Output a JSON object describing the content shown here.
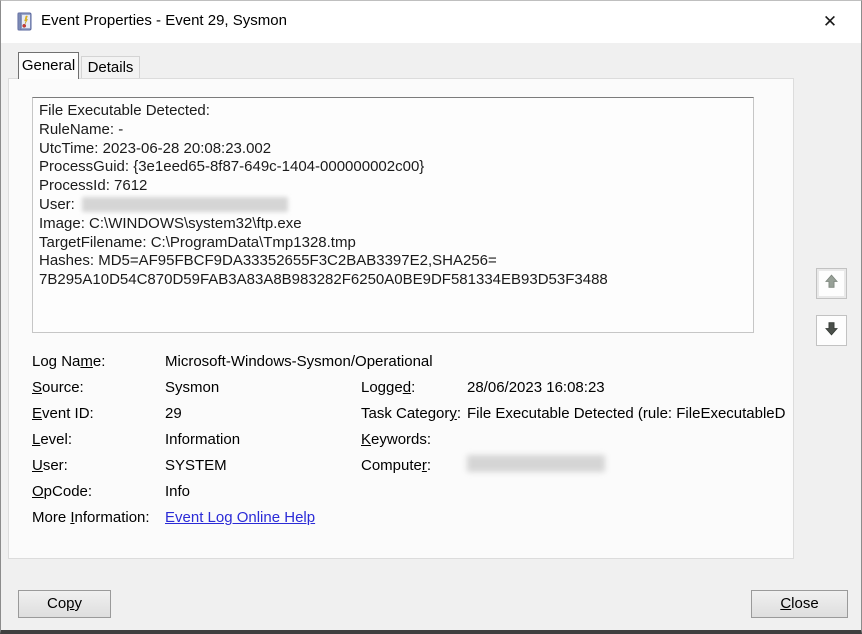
{
  "window": {
    "title": "Event Properties - Event 29, Sysmon",
    "close_glyph": "✕"
  },
  "tabs": {
    "general": "General",
    "details": "Details"
  },
  "description": {
    "lines": [
      "File Executable Detected:",
      "RuleName: -",
      "UtcTime: 2023-06-28 20:08:23.002",
      "ProcessGuid: {3e1eed65-8f87-649c-1404-000000002c00}",
      "ProcessId: 7612",
      "User:",
      "Image: C:\\WINDOWS\\system32\\ftp.exe",
      "TargetFilename: C:\\ProgramData\\Tmp1328.tmp",
      "Hashes: MD5=AF95FBCF9DA33352655F3C2BAB3397E2,SHA256=",
      "7B295A10D54C870D59FAB3A83A8B983282F6250A0BE9DF581334EB93D53F3488"
    ],
    "user_value_redacted": true
  },
  "fields": {
    "log_name": {
      "pre": "Log Na",
      "ac": "m",
      "post": "e:",
      "value": "Microsoft-Windows-Sysmon/Operational"
    },
    "source": {
      "pre": "",
      "ac": "S",
      "post": "ource:",
      "value": "Sysmon"
    },
    "event_id": {
      "pre": "",
      "ac": "E",
      "post": "vent ID:",
      "value": "29"
    },
    "level": {
      "pre": "",
      "ac": "L",
      "post": "evel:",
      "value": "Information"
    },
    "user": {
      "pre": "",
      "ac": "U",
      "post": "ser:",
      "value": "SYSTEM"
    },
    "opcode": {
      "pre": "",
      "ac": "O",
      "post": "pCode:",
      "value": "Info"
    },
    "more_info": {
      "pre": "More ",
      "ac": "I",
      "post": "nformation:",
      "link_text": "Event Log Online Help"
    },
    "logged": {
      "pre": "Logge",
      "ac": "d",
      "post": ":",
      "value": "28/06/2023 16:08:23"
    },
    "task_category": {
      "pre": "Task Categor",
      "ac": "y",
      "post": ":",
      "value": "File Executable Detected (rule: FileExecutableD"
    },
    "keywords": {
      "pre": "",
      "ac": "K",
      "post": "eywords:",
      "value": ""
    },
    "computer": {
      "pre": "Compute",
      "ac": "r",
      "post": ":",
      "value_redacted": true
    }
  },
  "buttons": {
    "copy": {
      "pre": "Co",
      "ac": "p",
      "post": "y"
    },
    "close": {
      "pre": "",
      "ac": "C",
      "post": "lose"
    }
  },
  "icons": {
    "title_icon": "event-log-icon",
    "up_arrow": "scroll-up-icon",
    "down_arrow": "scroll-down-icon"
  },
  "colors": {
    "link": "#2b2bd7",
    "titlebar_bg": "#ffffff",
    "dialog_bg": "#f0f0f0",
    "panel_bg": "#fbfbfb",
    "redaction": "#d5d5d5"
  }
}
